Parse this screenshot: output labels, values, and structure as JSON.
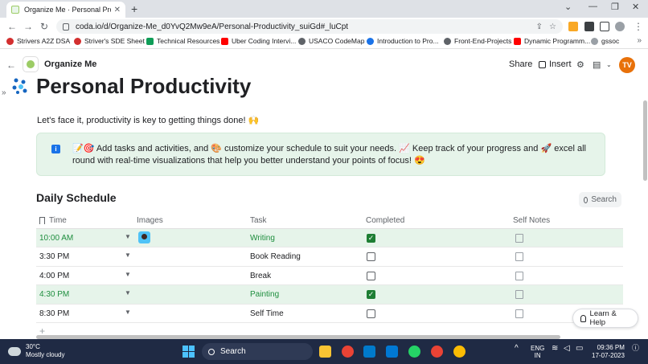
{
  "browser": {
    "tab_title": "Organize Me · Personal Productivity",
    "url": "coda.io/d/Organize-Me_d0YvQ2Mw9eA/Personal-Productivity_suiGd#_luCpt",
    "bookmarks": [
      {
        "label": "Strivers A2Z DSA",
        "color": "#d32f2f"
      },
      {
        "label": "Striver's SDE Sheet",
        "color": "#d32f2f"
      },
      {
        "label": "Technical Resources",
        "color": "#0f9d58"
      },
      {
        "label": "Uber Coding Intervi...",
        "color": "#ff0000"
      },
      {
        "label": "USACO CodeMap",
        "color": "#5f6368"
      },
      {
        "label": "Introduction to Pro...",
        "color": "#1a73e8"
      },
      {
        "label": "Front-End-Projects",
        "color": "#5f6368"
      },
      {
        "label": "Dynamic Programm...",
        "color": "#ff0000"
      },
      {
        "label": "gssoc",
        "color": "#9aa0a6"
      }
    ],
    "bookmarks_more": "»"
  },
  "coda": {
    "doc_name": "Organize Me",
    "share_label": "Share",
    "insert_label": "Insert",
    "avatar_initials": "TV",
    "avatar_color": "#e8710a"
  },
  "page": {
    "title": "Personal Productivity",
    "intro": "Let's face it, productivity is key to getting things done! 🙌",
    "callout": "📝🎯 Add tasks and activities, and 🎨 customize your schedule to suit your needs. 📈 Keep track of your progress and 🚀 excel all round with real-time visualizations that help you better understand your points of focus! 😍"
  },
  "schedule": {
    "title": "Daily Schedule",
    "search_label": "Search",
    "columns": {
      "time": "Time",
      "images": "Images",
      "task": "Task",
      "completed": "Completed",
      "notes": "Self Notes"
    },
    "rows": [
      {
        "time": "10:00 AM",
        "task": "Writing",
        "completed": true,
        "has_image": true
      },
      {
        "time": "3:30 PM",
        "task": "Book Reading",
        "completed": false,
        "has_image": false
      },
      {
        "time": "4:00 PM",
        "task": "Break",
        "completed": false,
        "has_image": false
      },
      {
        "time": "4:30 PM",
        "task": "Painting",
        "completed": true,
        "has_image": false
      },
      {
        "time": "8:30 PM",
        "task": "Self Time",
        "completed": false,
        "has_image": false
      }
    ],
    "add_row": "+"
  },
  "help": {
    "label": "Learn & Help"
  },
  "taskbar": {
    "temp": "30°C",
    "weather": "Mostly cloudy",
    "search": "Search",
    "lang": "ENG",
    "region": "IN",
    "time": "09:36 PM",
    "date": "17-07-2023"
  }
}
